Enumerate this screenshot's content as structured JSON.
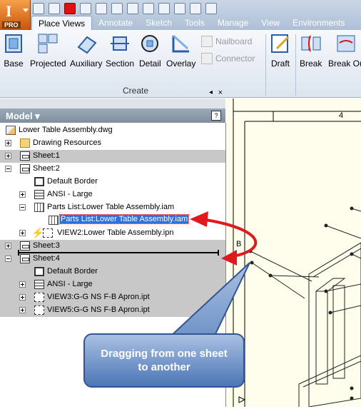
{
  "app": {
    "badge": "PRO",
    "logo_letter": "I"
  },
  "quick_access": {
    "icons": [
      "new-icon",
      "open-icon",
      "save-red-icon",
      "save-icon",
      "undo-icon",
      "redo-icon",
      "print-icon",
      "select-icon",
      "project-icon",
      "return-icon",
      "measure-icon",
      "plus-icon"
    ]
  },
  "tabs": [
    "Place Views",
    "Annotate",
    "Sketch",
    "Tools",
    "Manage",
    "View",
    "Environments"
  ],
  "active_tab": "Place Views",
  "ribbon": {
    "buttons": [
      "Base",
      "Projected",
      "Auxiliary",
      "Section",
      "Detail",
      "Overlay",
      "Draft",
      "Break",
      "Break Ou"
    ],
    "disabled": [
      "Nailboard",
      "Connector"
    ],
    "group_label": "Create"
  },
  "panel": {
    "title": "Model",
    "help": "?",
    "close": "×"
  },
  "tree": [
    {
      "label": "Lower Table Assembly.dwg",
      "icon": "drawing-file-icon"
    },
    {
      "label": "Drawing Resources",
      "icon": "folder-icon"
    },
    {
      "label": "Sheet:1",
      "icon": "sheet-icon"
    },
    {
      "label": "Sheet:2",
      "icon": "sheet-icon"
    },
    {
      "label": "Default Border",
      "icon": "border-icon"
    },
    {
      "label": "ANSI - Large",
      "icon": "title-block-icon"
    },
    {
      "label": "Parts List:Lower Table Assembly.iam",
      "icon": "parts-list-icon"
    },
    {
      "label": "Parts List:Lower Table Assembly.iam",
      "icon": "parts-list-icon"
    },
    {
      "label": "VIEW2:Lower Table Assembly.ipn",
      "icon": "view-icon"
    },
    {
      "label": "Sheet:3",
      "icon": "sheet-icon"
    },
    {
      "label": "Sheet:4",
      "icon": "sheet-icon"
    },
    {
      "label": "Default Border",
      "icon": "border-icon"
    },
    {
      "label": "ANSI - Large",
      "icon": "title-block-icon"
    },
    {
      "label": "VIEW3:G-G NS F-B Apron.ipt",
      "icon": "view-icon"
    },
    {
      "label": "VIEW5:G-G NS F-B Apron.ipt",
      "icon": "view-icon"
    }
  ],
  "canvas": {
    "zone_label": "4",
    "marker": "B"
  },
  "callout": {
    "text": "Dragging from one sheet\nto another"
  },
  "colors": {
    "accent": "#3070d8",
    "arrow": "#e0191e",
    "callout": "#4c76b6"
  }
}
